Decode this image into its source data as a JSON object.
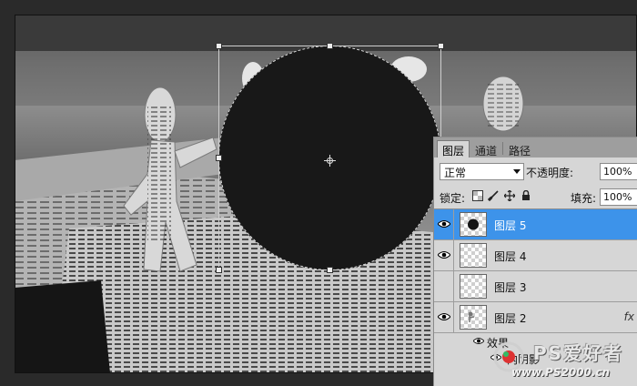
{
  "panel": {
    "tabs": [
      {
        "label": "图层",
        "active": true
      },
      {
        "label": "通道",
        "active": false
      },
      {
        "label": "路径",
        "active": false
      }
    ],
    "blend_mode": "正常",
    "opacity_label": "不透明度:",
    "opacity_value": "100%",
    "lock_label": "锁定:",
    "lock_icons": [
      "lock-transparent-icon",
      "lock-brush-icon",
      "lock-move-icon",
      "lock-all-icon"
    ],
    "fill_label": "填充:",
    "fill_value": "100%",
    "layers": [
      {
        "name": "图层 5",
        "selected": true,
        "thumb": "black-circle"
      },
      {
        "name": "图层 4",
        "selected": false,
        "thumb": "empty"
      },
      {
        "name": "图层 3",
        "selected": false,
        "thumb": "empty"
      },
      {
        "name": "图层 2",
        "selected": false,
        "thumb": "figure",
        "fx": "fx"
      }
    ],
    "effects_label": "效果",
    "effect_item": "内阴影",
    "selected_color": "#3d93ea"
  },
  "watermark": {
    "title": "PS爱好者",
    "url": "www.PS2000.cn"
  },
  "shape_color": "#181818"
}
